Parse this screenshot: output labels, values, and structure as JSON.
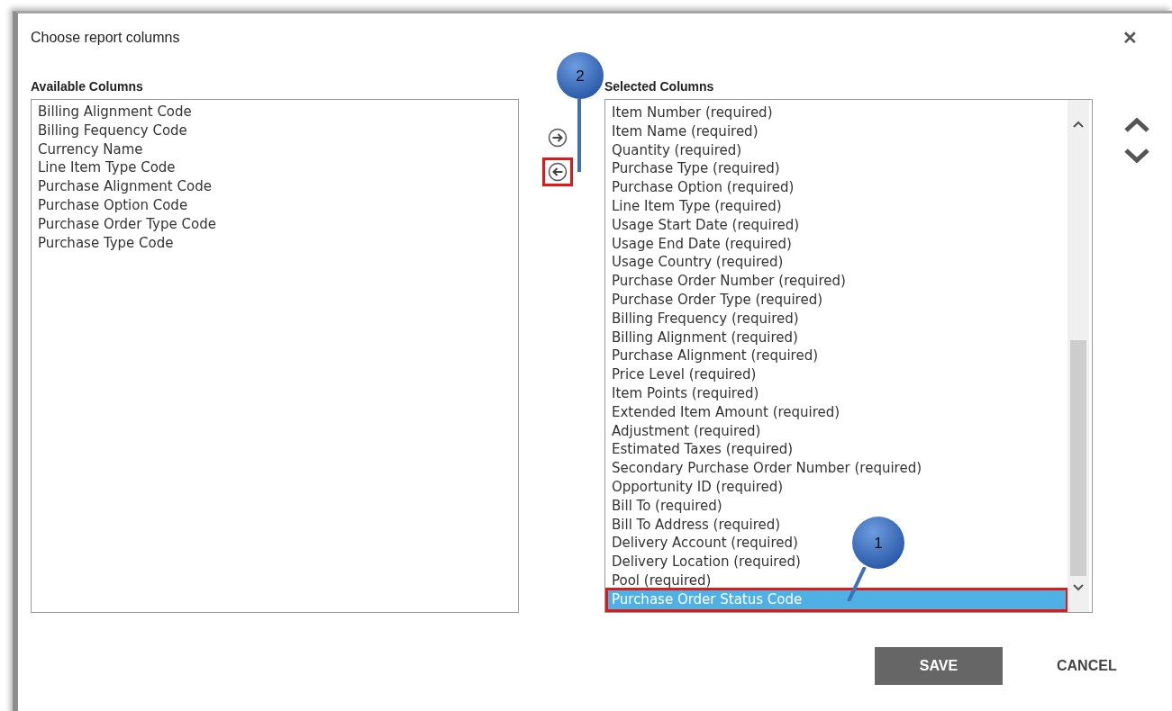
{
  "dialog": {
    "title": "Choose report columns",
    "close": "✕"
  },
  "available": {
    "heading": "Available Columns",
    "items": [
      {
        "label": "Billing Alignment Code",
        "selected": false
      },
      {
        "label": "Billing Fequency Code",
        "selected": false
      },
      {
        "label": "Currency Name",
        "selected": false
      },
      {
        "label": "Line Item Type Code",
        "selected": false
      },
      {
        "label": "Purchase Alignment Code",
        "selected": false
      },
      {
        "label": "Purchase Option Code",
        "selected": false
      },
      {
        "label": "Purchase Order Type Code",
        "selected": false
      },
      {
        "label": "Purchase Type Code",
        "selected": false
      }
    ]
  },
  "move_buttons": [
    {
      "kind": "add",
      "highlighted": false
    },
    {
      "kind": "remove",
      "highlighted": true
    }
  ],
  "selected": {
    "heading": "Selected Columns",
    "items": [
      {
        "label": "Item Number (required)",
        "selected": false,
        "highlighted": false
      },
      {
        "label": "Item Name (required)",
        "selected": false,
        "highlighted": false
      },
      {
        "label": "Quantity (required)",
        "selected": false,
        "highlighted": false
      },
      {
        "label": "Purchase Type (required)",
        "selected": false,
        "highlighted": false
      },
      {
        "label": "Purchase Option (required)",
        "selected": false,
        "highlighted": false
      },
      {
        "label": "Line Item Type (required)",
        "selected": false,
        "highlighted": false
      },
      {
        "label": "Usage Start Date (required)",
        "selected": false,
        "highlighted": false
      },
      {
        "label": "Usage End Date (required)",
        "selected": false,
        "highlighted": false
      },
      {
        "label": "Usage Country (required)",
        "selected": false,
        "highlighted": false
      },
      {
        "label": "Purchase Order Number (required)",
        "selected": false,
        "highlighted": false
      },
      {
        "label": "Purchase Order Type (required)",
        "selected": false,
        "highlighted": false
      },
      {
        "label": "Billing Frequency (required)",
        "selected": false,
        "highlighted": false
      },
      {
        "label": "Billing Alignment (required)",
        "selected": false,
        "highlighted": false
      },
      {
        "label": "Purchase Alignment (required)",
        "selected": false,
        "highlighted": false
      },
      {
        "label": "Price Level (required)",
        "selected": false,
        "highlighted": false
      },
      {
        "label": "Item Points (required)",
        "selected": false,
        "highlighted": false
      },
      {
        "label": "Extended Item Amount (required)",
        "selected": false,
        "highlighted": false
      },
      {
        "label": "Adjustment (required)",
        "selected": false,
        "highlighted": false
      },
      {
        "label": "Estimated Taxes (required)",
        "selected": false,
        "highlighted": false
      },
      {
        "label": "Secondary Purchase Order Number (required)",
        "selected": false,
        "highlighted": false
      },
      {
        "label": "Opportunity ID (required)",
        "selected": false,
        "highlighted": false
      },
      {
        "label": "Bill To (required)",
        "selected": false,
        "highlighted": false
      },
      {
        "label": "Bill To Address (required)",
        "selected": false,
        "highlighted": false
      },
      {
        "label": "Delivery Account (required)",
        "selected": false,
        "highlighted": false
      },
      {
        "label": "Delivery Location (required)",
        "selected": false,
        "highlighted": false
      },
      {
        "label": "Pool (required)",
        "selected": false,
        "highlighted": false
      },
      {
        "label": "Purchase Order Status Code",
        "selected": true,
        "highlighted": true
      }
    ]
  },
  "callouts": [
    {
      "number": "2"
    },
    {
      "number": "1"
    }
  ],
  "buttons": [
    {
      "kind": "primary",
      "label": "SAVE"
    },
    {
      "kind": "link",
      "label": "CANCEL"
    }
  ]
}
